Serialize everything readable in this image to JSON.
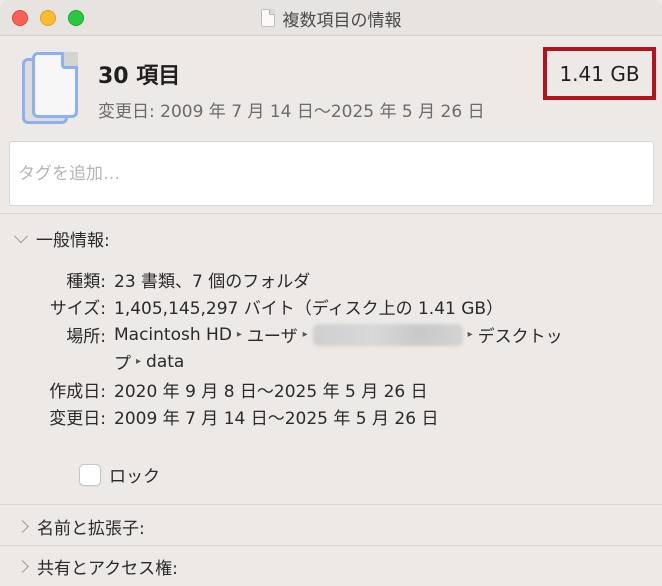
{
  "window": {
    "title": "複数項目の情報"
  },
  "header": {
    "item_count": "30 項目",
    "modified_range": "変更日: 2009 年 7 月 14 日〜2025 年 5 月 26 日",
    "total_size": "1.41 GB"
  },
  "tags": {
    "placeholder": "タグを追加…",
    "value": ""
  },
  "general": {
    "section_label": "一般情報:",
    "rows": [
      {
        "label": "種類:",
        "value": "23 書類、7 個のフォルダ"
      },
      {
        "label": "サイズ:",
        "value": "1,405,145,297 バイト（ディスク上の 1.41 GB）"
      },
      {
        "label": "場所:"
      },
      {
        "label": "作成日:",
        "value": "2020 年 9 月 8 日〜2025 年 5 月 26 日"
      },
      {
        "label": "変更日:",
        "value": "2009 年 7 月 14 日〜2025 年 5 月 26 日"
      }
    ],
    "location": {
      "volume": "Macintosh HD",
      "users": "ユーザ",
      "desktop_part1": "デスクトッ",
      "desktop_part2": "プ",
      "folder": "data",
      "separator": "▸"
    },
    "lock_label": "ロック",
    "lock_checked": false
  },
  "sections": {
    "name_extension": "名前と拡張子:",
    "sharing_permissions": "共有とアクセス権:"
  },
  "colors": {
    "highlight_border": "#b3141c",
    "icon_outline": "#8fb0f0",
    "close": "#fe5f57",
    "minimize": "#febc2e",
    "maximize": "#28c840"
  }
}
